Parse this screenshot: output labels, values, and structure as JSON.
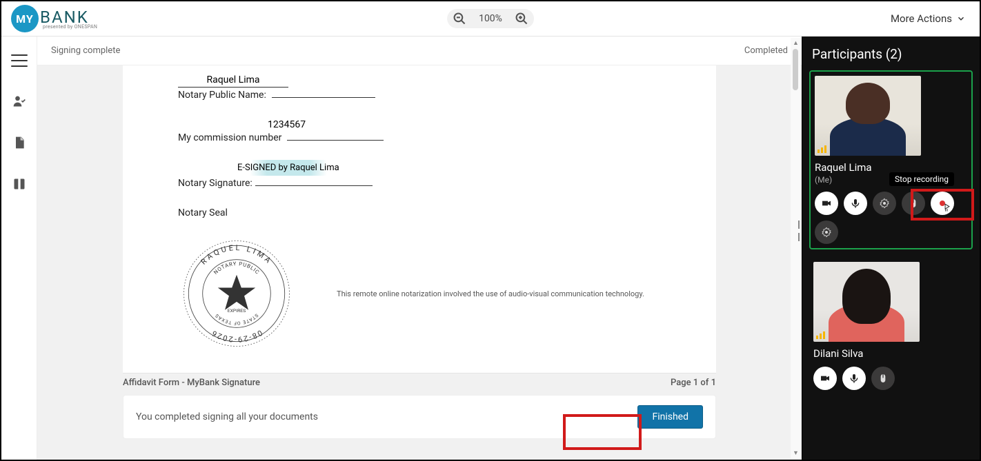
{
  "header": {
    "logo_circle": "MY",
    "logo_text": "BANK",
    "logo_sub": "presented by ONESPAN",
    "zoom_value": "100%",
    "more_actions": "More Actions"
  },
  "status": {
    "left": "Signing complete",
    "right": "Completed"
  },
  "document": {
    "notary_name_label": "Notary Public Name:",
    "notary_name_value": "Raquel Lima",
    "commission_label": "My commission number",
    "commission_value": "1234567",
    "signature_label": "Notary Signature:",
    "signature_value": "E-SIGNED by Raquel Lima",
    "seal_label": "Notary Seal",
    "seal_text_top": "RAQUEL LIMA",
    "seal_text_inner_top": "NOTARY PUBLIC",
    "seal_text_inner_mid": "STATE OF TEXAS",
    "seal_text_inner_bot": "EXPIRES",
    "seal_date": "08-29-2026",
    "disclaimer": "This remote online notarization involved the use of audio-visual communication technology.",
    "doc_title": "Affidavit Form - MyBank Signature",
    "page_info": "Page 1 of 1",
    "completed_msg": "You completed signing all your documents",
    "finished_btn": "Finished"
  },
  "video": {
    "panel_title": "Participants (2)",
    "p1_name": "Raquel Lima",
    "p1_me": "(Me)",
    "p2_name": "Dilani Silva",
    "tooltip_stop_rec": "Stop recording"
  }
}
